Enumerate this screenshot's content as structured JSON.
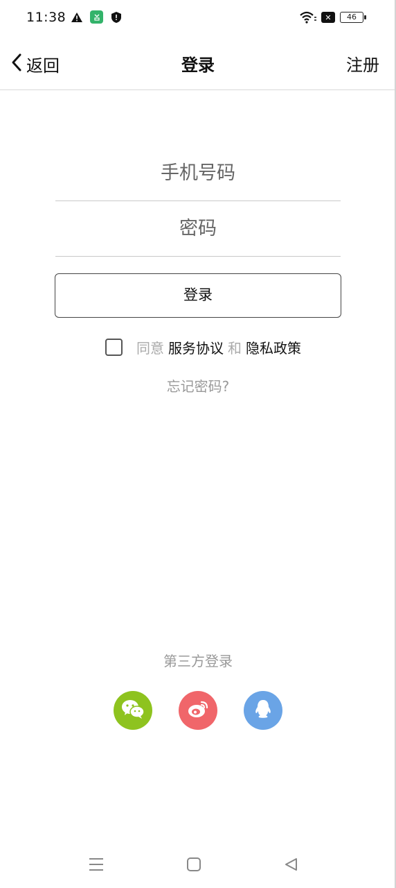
{
  "status_bar": {
    "time": "11:38",
    "battery": "46",
    "icons": [
      "warning-icon",
      "app-notification-icon",
      "shield-icon",
      "wifi-icon",
      "sim-blocked-icon",
      "battery-icon"
    ]
  },
  "nav": {
    "back_label": "返回",
    "title": "登录",
    "register_label": "注册"
  },
  "form": {
    "phone_placeholder": "手机号码",
    "phone_value": "",
    "password_placeholder": "密码",
    "password_value": "",
    "login_button": "登录",
    "agree_checked": false,
    "agree_prefix": "同意",
    "service_agreement": "服务协议",
    "and_text": "和",
    "privacy_policy": "隐私政策",
    "forgot_password": "忘记密码?"
  },
  "third_party": {
    "title": "第三方登录",
    "providers": [
      {
        "name": "wechat",
        "icon": "wechat-icon",
        "color": "#8ec31f"
      },
      {
        "name": "weibo",
        "icon": "weibo-icon",
        "color": "#f0666a"
      },
      {
        "name": "qq",
        "icon": "qq-icon",
        "color": "#6aa4e6"
      }
    ]
  },
  "system_nav": {
    "icons": [
      "menu-icon",
      "home-icon",
      "back-triangle-icon"
    ]
  }
}
